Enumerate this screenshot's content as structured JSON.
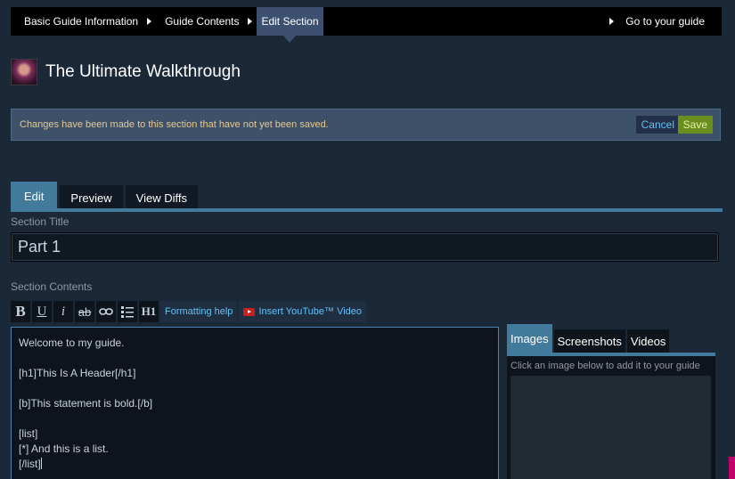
{
  "nav": {
    "crumbs": [
      "Basic Guide Information",
      "Guide Contents",
      "Edit Section"
    ],
    "goto": "Go to your guide"
  },
  "guide": {
    "title": "The Ultimate Walkthrough"
  },
  "banner": {
    "message": "Changes have been made to this section that have not yet been saved.",
    "cancel": "Cancel",
    "save": "Save"
  },
  "tabs": {
    "edit": "Edit",
    "preview": "Preview",
    "diffs": "View Diffs"
  },
  "section_title": {
    "label": "Section Title",
    "value": "Part 1"
  },
  "section_contents": {
    "label": "Section Contents"
  },
  "toolbar": {
    "bold": "B",
    "underline": "U",
    "italic": "i",
    "strike": "ab",
    "h1": "H1",
    "formatting_help": "Formatting help",
    "insert_youtube": "Insert YouTube™ Video"
  },
  "editor": {
    "lines": [
      "Welcome to my guide.",
      "",
      "[h1]This Is A Header[/h1]",
      "",
      "[b]This statement is bold.[/b]",
      "",
      "[list]",
      "[*] And this is a list.",
      "[/list]"
    ]
  },
  "media": {
    "tabs": [
      "Images",
      "Screenshots",
      "Videos"
    ],
    "hint": "Click an image below to add it to your guide"
  },
  "colors": {
    "background": "#1b2838",
    "accent": "#417a9b",
    "save": "#6a8e1c",
    "link": "#67c1f5"
  }
}
